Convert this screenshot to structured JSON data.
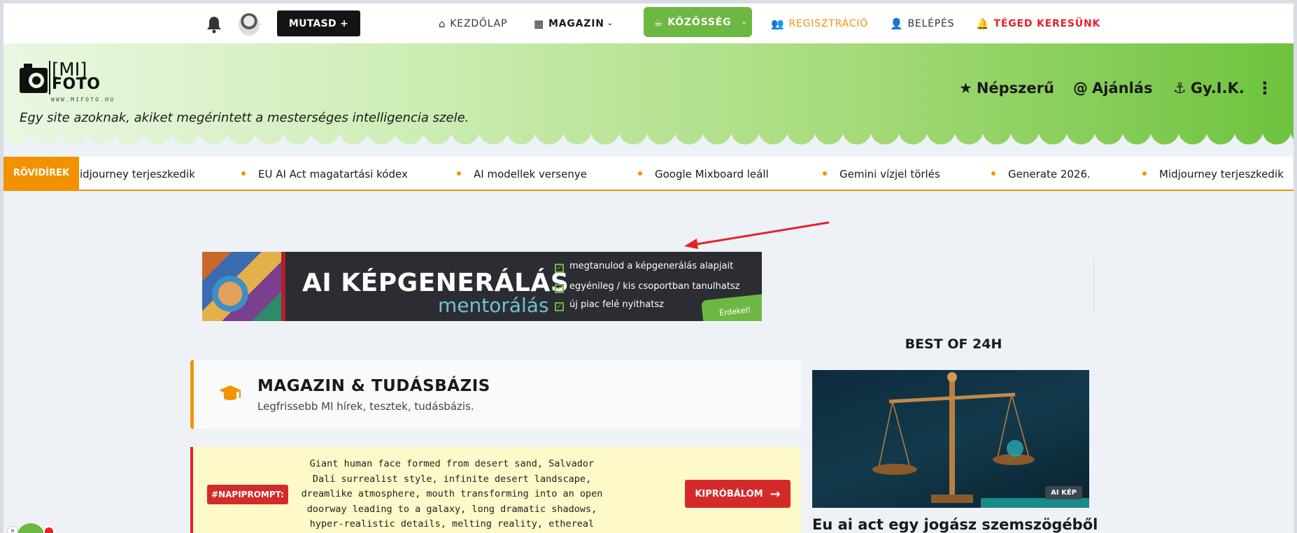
{
  "topnav": {
    "show_button": "MUTASD +",
    "links": {
      "home": "KEZDŐLAP",
      "magazin": "MAGAZIN",
      "community": "KÖZÖSSÉG",
      "register": "REGISZTRÁCIÓ",
      "login": "BELÉPÉS",
      "wanted": "TÉGED KERESÜNK"
    }
  },
  "header": {
    "logo_mi": "[MI]",
    "logo_foto": "FOTO",
    "logo_url": "WWW.MIFOTO.HU",
    "tagline": "Egy site azoknak, akiket megérintett a mesterséges intelligencia szele.",
    "links": {
      "popular": "Népszerű",
      "recommend": "Ajánlás",
      "faq": "Gy.I.K."
    }
  },
  "ticker": {
    "label": "RÖVIDÍREK",
    "items": [
      "Midjourney terjeszkedik",
      "EU AI Act magatartási kódex",
      "AI modellek versenye",
      "Google Mixboard leáll",
      "Gemini vízjel törlés",
      "Generate 2026.",
      "Midjourney terjeszkedik"
    ]
  },
  "banner": {
    "title": "AI KÉPGENERÁLÁS",
    "subtitle": "mentorálás",
    "bullets": [
      "megtanulod a képgenerálás alapjait",
      "egyénileg / kis csoportban tanulhatsz",
      "új piac felé nyithatsz"
    ],
    "cta": "Érdekel!"
  },
  "bestof": {
    "title": "BEST OF 24H",
    "badge": "AI KÉP",
    "headline": "Eu ai act egy jogász szemszögéből"
  },
  "magazin": {
    "title": "MAGAZIN & TUDÁSBÁZIS",
    "subtitle": "Legfrissebb MI hírek, tesztek, tudásbázis."
  },
  "prompt": {
    "tag": "#NAPIPROMPT:",
    "text": "Giant human face formed from desert sand, Salvador Dalí surrealist style, infinite desert landscape, dreamlike atmosphere, mouth transforming into an open doorway leading to a galaxy, long dramatic shadows, hyper-realistic details, melting reality, ethereal lighting.",
    "button": "KIPRÓBÁLOM"
  },
  "colors": {
    "accent_green": "#6db843",
    "accent_orange": "#f39200",
    "accent_red": "#e8202a"
  }
}
